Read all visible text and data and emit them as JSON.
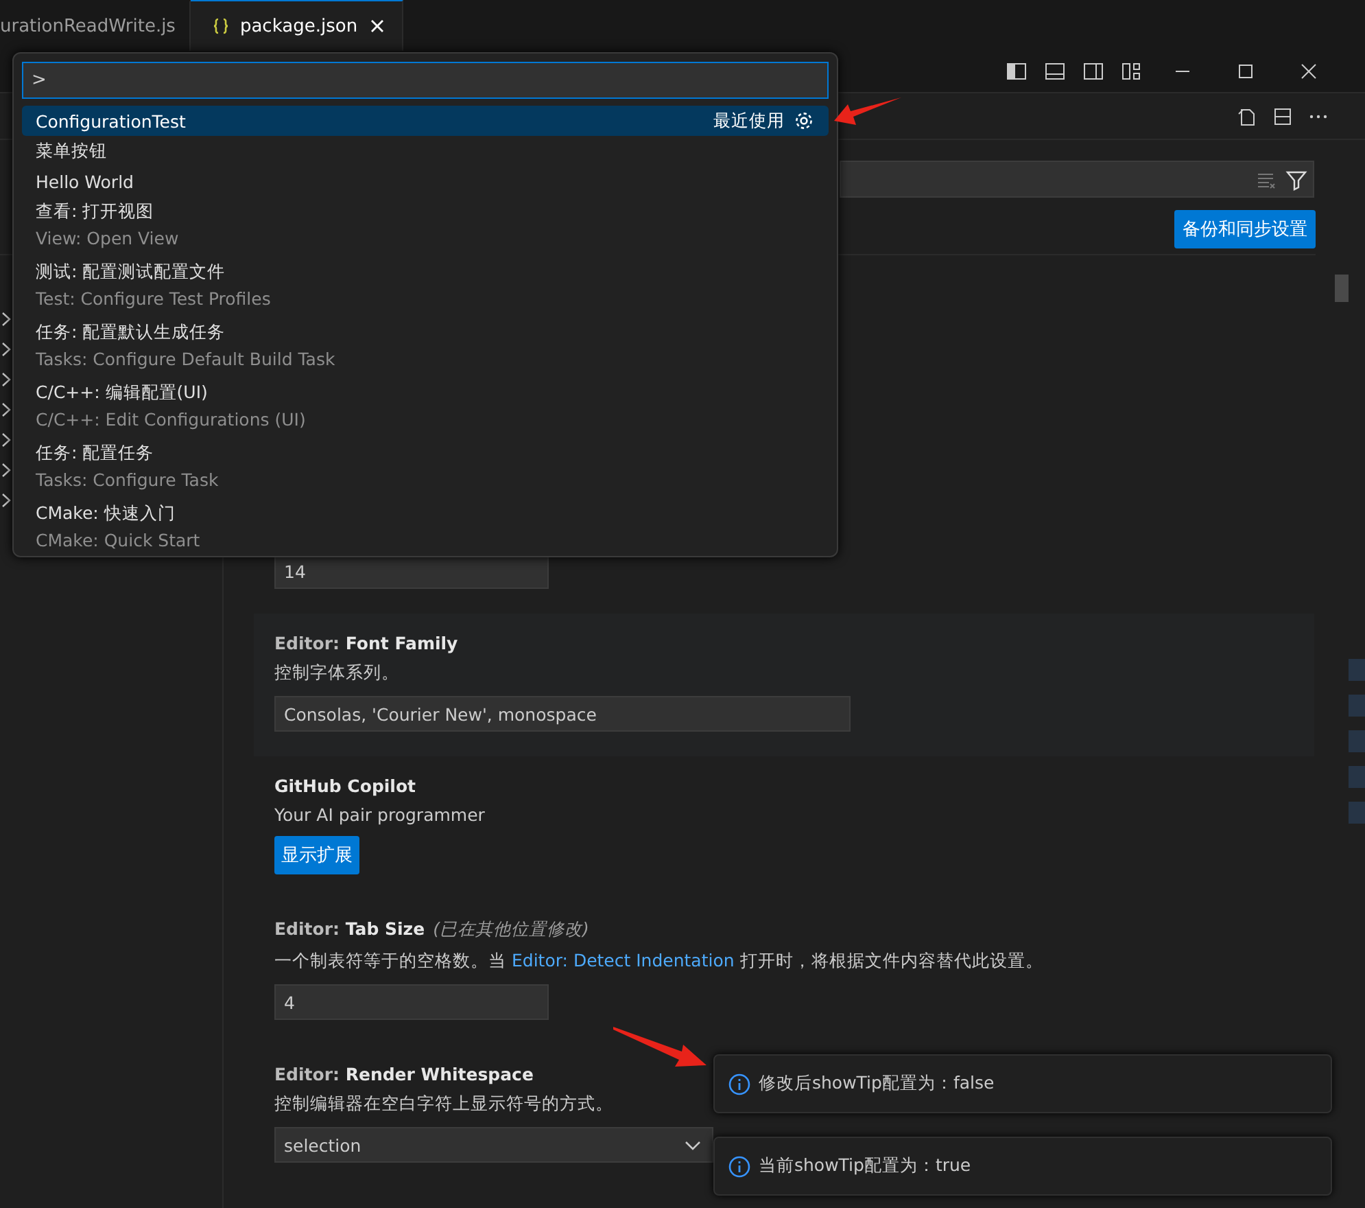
{
  "tabs": [
    {
      "label": "urationReadWrite.js",
      "kind": "js",
      "selected": false
    },
    {
      "label": "package.json",
      "kind": "json",
      "selected": true
    }
  ],
  "header": {
    "sync_button": "备份和同步设置"
  },
  "tree": {
    "items": [
      {
        "expanded": false
      },
      {
        "expanded": false
      },
      {
        "expanded": false
      },
      {
        "expanded": false
      },
      {
        "expanded": false
      },
      {
        "expanded": false
      },
      {
        "expanded": false
      }
    ]
  },
  "settings": [
    {
      "kind": "input",
      "value": "14"
    },
    {
      "kind": "input",
      "category": "Editor:",
      "title": "Font Family",
      "description": "控制字体系列。",
      "value": "Consolas, 'Courier New', monospace",
      "focused": true
    },
    {
      "kind": "extension",
      "title": "GitHub Copilot",
      "description": "Your AI pair programmer",
      "button": "显示扩展"
    },
    {
      "kind": "input",
      "category": "Editor:",
      "title": "Tab Size",
      "note": "(已在其他位置修改)",
      "description": "一个制表符等于的空格数。当",
      "link": "Editor: Detect Indentation",
      "description_after": "打开时，将根据文件内容替代此设置。",
      "value": "4"
    },
    {
      "kind": "select",
      "category": "Editor:",
      "title": "Render Whitespace",
      "description": "控制编辑器在空白字符上显示符号的方式。",
      "value": "selection"
    }
  ],
  "command_palette": {
    "value": ">",
    "items": [
      {
        "label": "ConfigurationTest",
        "selected": true,
        "badge": "最近使用"
      },
      {
        "label": "菜单按钮",
        "selected": false
      },
      {
        "label": "Hello World",
        "selected": false
      },
      {
        "label": "查看: 打开视图",
        "detail": "View: Open View",
        "selected": false
      },
      {
        "label": "测试: 配置测试配置文件",
        "detail": "Test: Configure Test Profiles",
        "selected": false
      },
      {
        "label": "任务: 配置默认生成任务",
        "detail": "Tasks: Configure Default Build Task",
        "selected": false
      },
      {
        "label": "C/C++: 编辑配置(UI)",
        "detail": "C/C++: Edit Configurations (UI)",
        "selected": false
      },
      {
        "label": "任务: 配置任务",
        "detail": "Tasks: Configure Task",
        "selected": false
      },
      {
        "label": "CMake: 快速入门",
        "detail": "CMake: Quick Start",
        "selected": false
      }
    ]
  },
  "notifications": [
    {
      "kind": "info",
      "message": "修改后showTip配置为：false"
    },
    {
      "kind": "info",
      "message": "当前showTip配置为：true"
    }
  ]
}
